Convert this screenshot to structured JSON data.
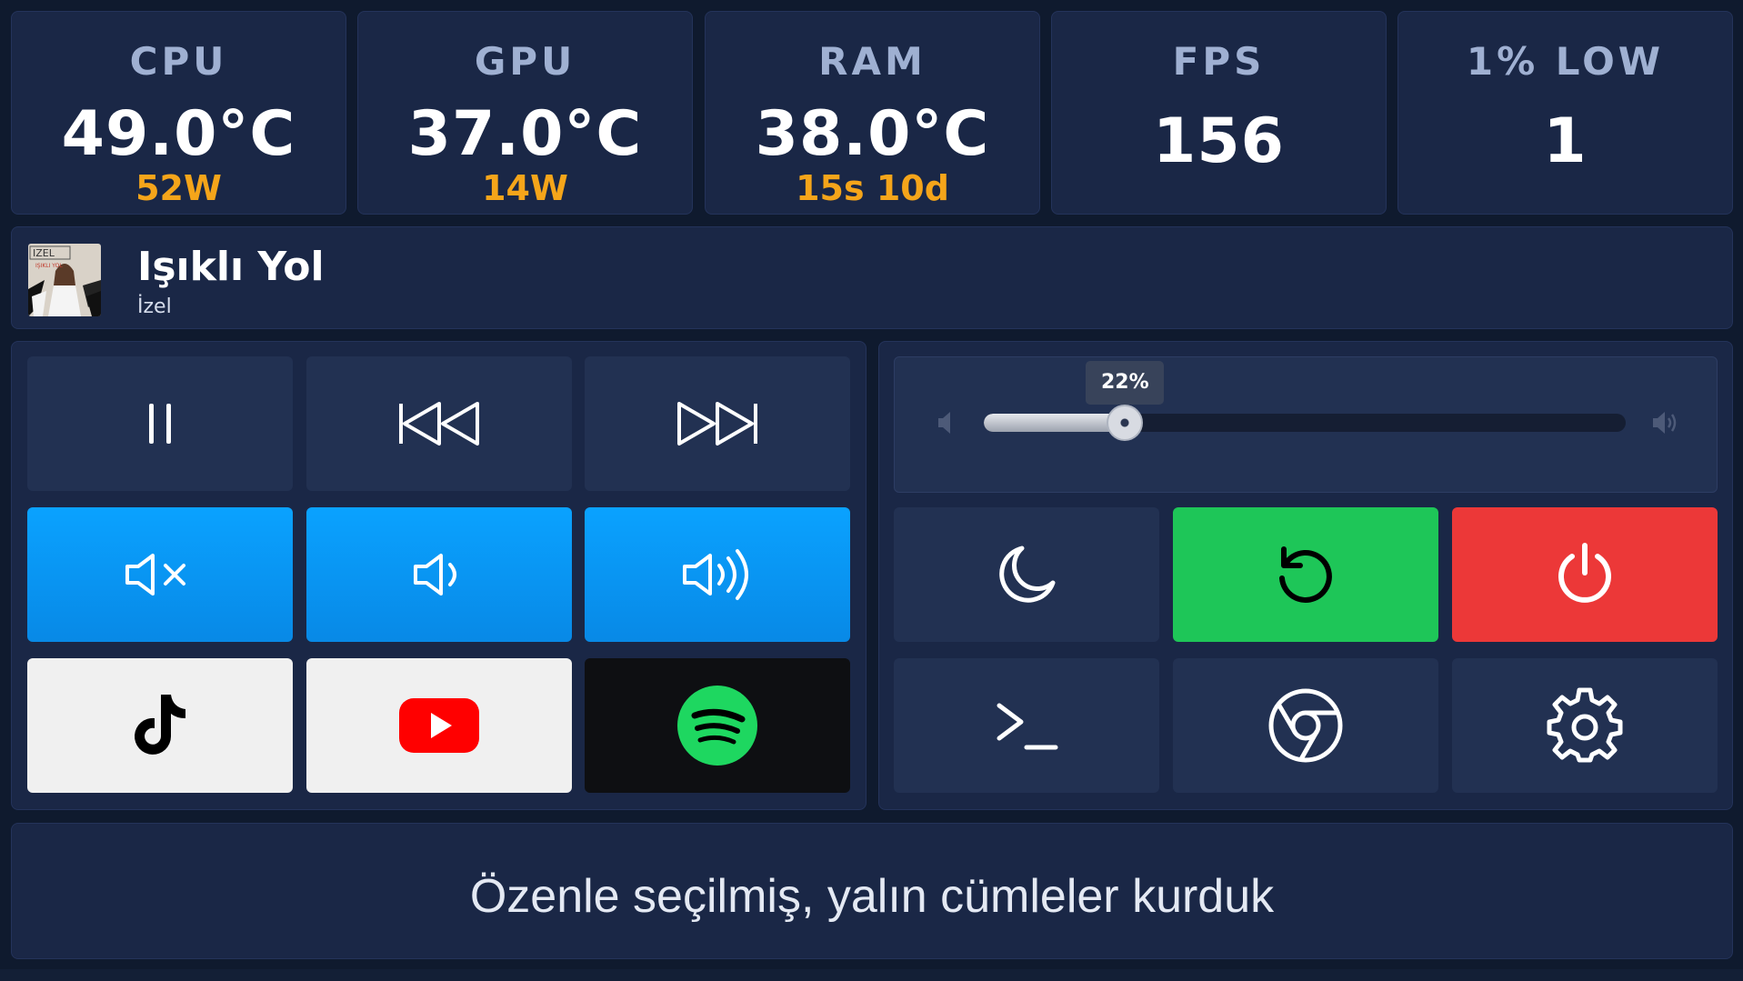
{
  "stats": [
    {
      "label": "CPU",
      "value": "49.0°C",
      "sub": "52W"
    },
    {
      "label": "GPU",
      "value": "37.0°C",
      "sub": "14W"
    },
    {
      "label": "RAM",
      "value": "38.0°C",
      "sub": "15s 10d"
    },
    {
      "label": "FPS",
      "value": "156",
      "sub": ""
    },
    {
      "label": "1% LOW",
      "value": "1",
      "sub": ""
    }
  ],
  "now_playing": {
    "title": "Işıklı Yol",
    "artist": "İzel",
    "album_art_text": "IZEL IŞIKLI YOL"
  },
  "media_buttons": [
    {
      "name": "pause",
      "icon": "pause-icon"
    },
    {
      "name": "previous",
      "icon": "skip-back-icon"
    },
    {
      "name": "next",
      "icon": "skip-forward-icon"
    },
    {
      "name": "mute",
      "icon": "volume-mute-icon"
    },
    {
      "name": "volume-down",
      "icon": "volume-low-icon"
    },
    {
      "name": "volume-up",
      "icon": "volume-high-icon"
    },
    {
      "name": "tiktok",
      "icon": "tiktok-icon"
    },
    {
      "name": "youtube",
      "icon": "youtube-icon"
    },
    {
      "name": "spotify",
      "icon": "spotify-icon"
    }
  ],
  "volume": {
    "value": 22,
    "label": "22%"
  },
  "system_buttons": [
    {
      "name": "sleep",
      "icon": "moon-icon"
    },
    {
      "name": "restart",
      "icon": "restart-icon"
    },
    {
      "name": "shutdown",
      "icon": "power-icon"
    },
    {
      "name": "terminal",
      "icon": "terminal-icon"
    },
    {
      "name": "chrome",
      "icon": "chrome-icon"
    },
    {
      "name": "settings",
      "icon": "gear-icon"
    }
  ],
  "footer": {
    "text": "Özenle seçilmiş, yalın cümleler kurduk"
  },
  "colors": {
    "background": "#0f1a2e",
    "panel": "#1a2746",
    "accent_orange": "#f5a51a",
    "blue": "#0aa2ff",
    "green": "#1ec658",
    "red": "#ec3838"
  }
}
